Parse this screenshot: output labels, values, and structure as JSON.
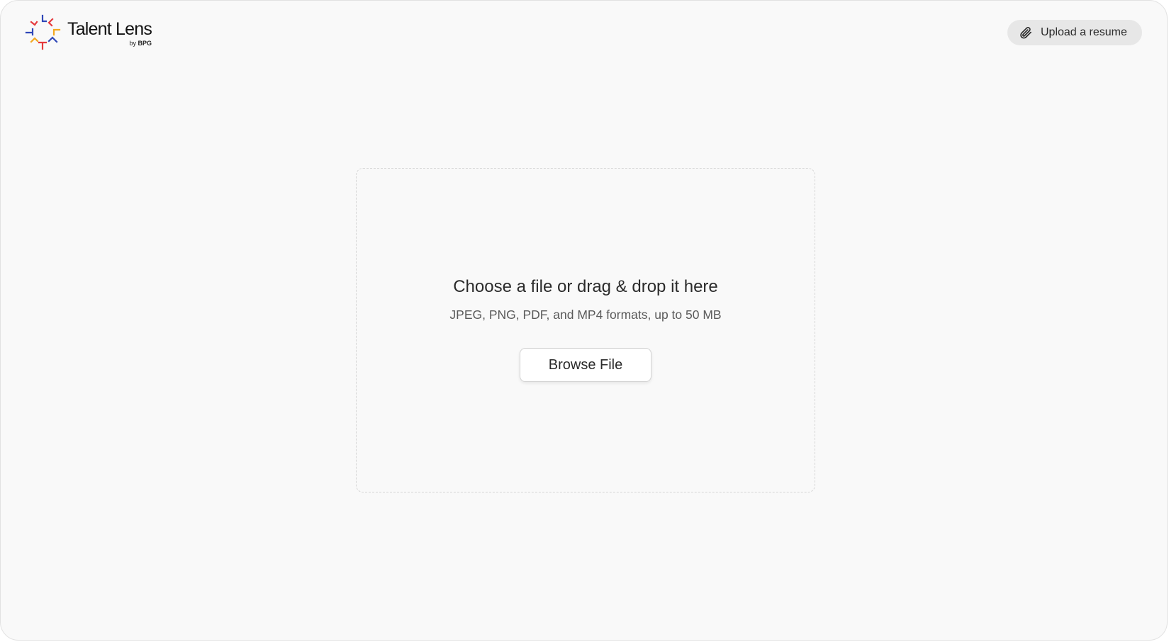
{
  "header": {
    "logo": {
      "name": "Talent Lens",
      "by_prefix": "by",
      "by_brand": "BPG",
      "icon": "talent-lens-logo-icon",
      "colors": [
        "#e5393d",
        "#2f47b8",
        "#f3a81f"
      ]
    },
    "upload_button": {
      "label": "Upload a resume",
      "icon": "paperclip-icon"
    }
  },
  "dropzone": {
    "title": "Choose a file or drag & drop it here",
    "subtitle": "JPEG, PNG, PDF, and MP4 formats, up to 50 MB",
    "browse_label": "Browse File"
  }
}
